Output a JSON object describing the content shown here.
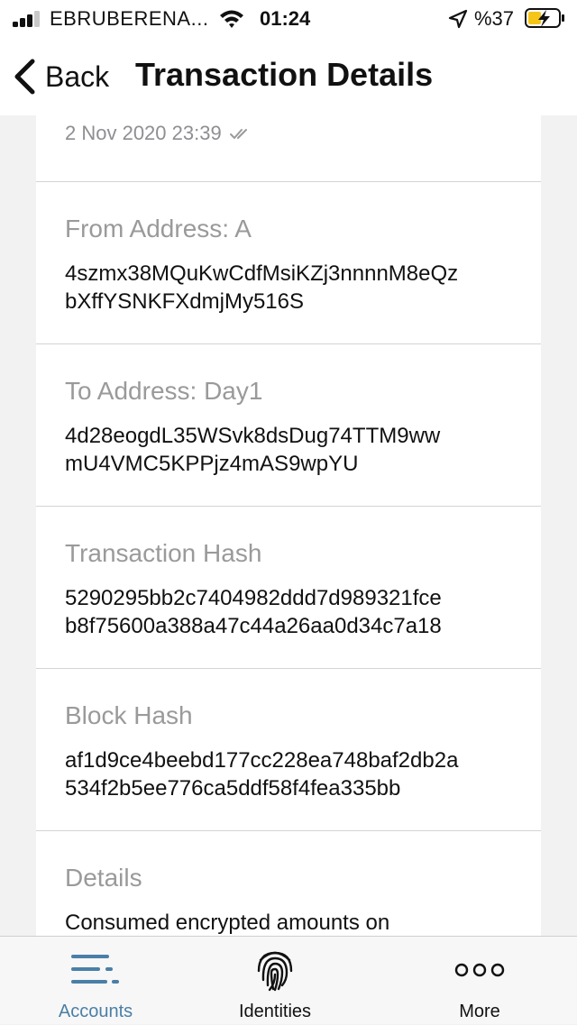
{
  "status_bar": {
    "carrier": "EBRUBERENA...",
    "time": "01:24",
    "battery_percent": "%37",
    "signal_bars_active": 3
  },
  "nav": {
    "back_label": "Back",
    "title": "Transaction Details"
  },
  "transaction": {
    "date": "2 Nov 2020 23:39",
    "sections": [
      {
        "label": "From Address: A",
        "value_line1": "4szmx38MQuKwCdfMsiKZj3nnnnM8eQz",
        "value_line2": "bXffYSNKFXdmjMy516S"
      },
      {
        "label": "To Address: Day1",
        "value_line1": "4d28eogdL35WSvk8dsDug74TTM9ww",
        "value_line2": "mU4VMC5KPPjz4mAS9wpYU"
      },
      {
        "label": "Transaction Hash",
        "value_line1": "5290295bb2c7404982ddd7d989321fce",
        "value_line2": "b8f75600a388a47c44a26aa0d34c7a18"
      },
      {
        "label": "Block Hash",
        "value_line1": "af1d9ce4beebd177cc228ea748baf2db2a",
        "value_line2": "534f2b5ee776ca5ddf58f4fea335bb"
      },
      {
        "label": "Details",
        "value_line1": "Consumed encrypted amounts on",
        "value_line2": ""
      }
    ]
  },
  "tabs": [
    {
      "label": "Accounts",
      "icon": "accounts-list-icon",
      "active": true
    },
    {
      "label": "Identities",
      "icon": "fingerprint-icon",
      "active": false
    },
    {
      "label": "More",
      "icon": "more-dots-icon",
      "active": false
    }
  ],
  "colors": {
    "accent": "#4a7fa7",
    "label_gray": "#9a9a9a",
    "background": "#f2f2f2",
    "battery_charging": "#f5c518"
  }
}
